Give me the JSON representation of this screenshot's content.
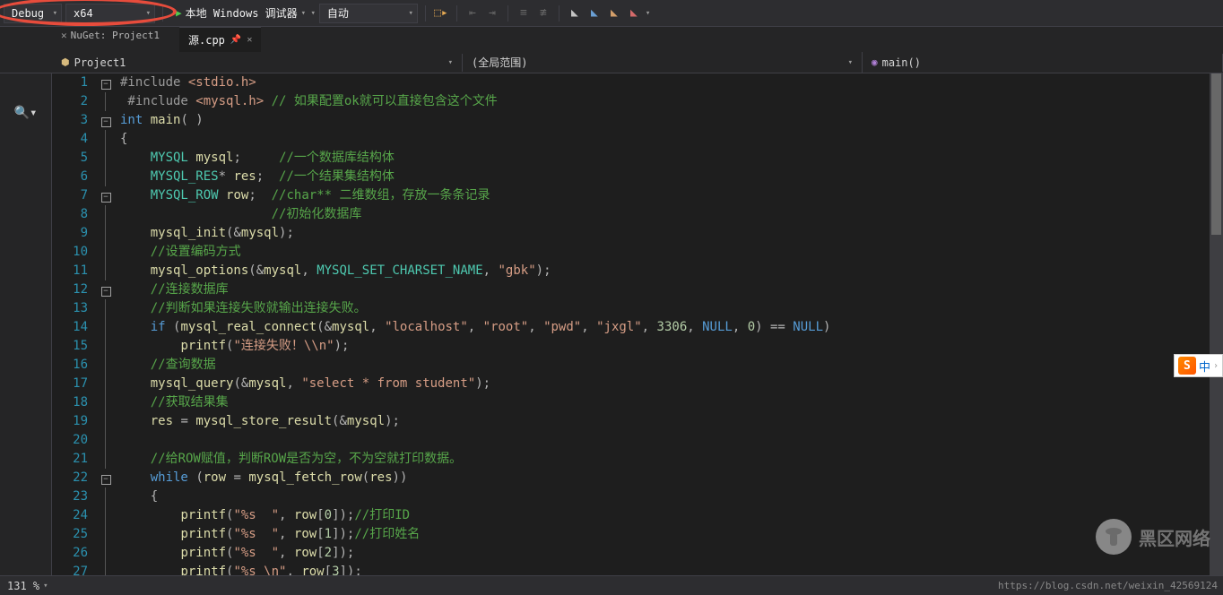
{
  "toolbar": {
    "config": "Debug",
    "platform": "x64",
    "debugger": "本地 Windows 调试器",
    "auto": "自动"
  },
  "dirtyTab": {
    "label": "NuGet: Project1"
  },
  "tab": {
    "label": "源.cpp"
  },
  "nav": {
    "project": "Project1",
    "scope": "(全局范围)",
    "func": "main()"
  },
  "status": {
    "zoom": "131 %"
  },
  "ime": {
    "letter": "S",
    "text": "中"
  },
  "watermark": "黑区网络",
  "attribution": "https://blog.csdn.net/weixin_42569124",
  "code": {
    "lines": [
      {
        "n": "1",
        "fold": "box",
        "tokens": [
          [
            "pp",
            "#include "
          ],
          [
            "str",
            "<stdio.h>"
          ]
        ]
      },
      {
        "n": "2",
        "fold": "bar",
        "tokens": [
          [
            "pp",
            " #include "
          ],
          [
            "str",
            "<mysql.h>"
          ],
          [
            "txt",
            " "
          ],
          [
            "cmt",
            "// 如果配置ok就可以直接包含这个文件"
          ]
        ]
      },
      {
        "n": "3",
        "fold": "box",
        "tokens": [
          [
            "kw",
            "int"
          ],
          [
            "txt",
            " "
          ],
          [
            "id",
            "main"
          ],
          [
            "op",
            "( )"
          ]
        ]
      },
      {
        "n": "4",
        "fold": "bar",
        "tokens": [
          [
            "op",
            "{"
          ]
        ]
      },
      {
        "n": "5",
        "fold": "bar",
        "tokens": [
          [
            "txt",
            "    "
          ],
          [
            "type",
            "MYSQL"
          ],
          [
            "txt",
            " "
          ],
          [
            "id",
            "mysql"
          ],
          [
            "op",
            ";"
          ],
          [
            "txt",
            "     "
          ],
          [
            "cmt",
            "//一个数据库结构体"
          ]
        ]
      },
      {
        "n": "6",
        "fold": "bar",
        "tokens": [
          [
            "txt",
            "    "
          ],
          [
            "type",
            "MYSQL_RES"
          ],
          [
            "op",
            "*"
          ],
          [
            "txt",
            " "
          ],
          [
            "id",
            "res"
          ],
          [
            "op",
            ";"
          ],
          [
            "txt",
            "  "
          ],
          [
            "cmt",
            "//一个结果集结构体"
          ]
        ]
      },
      {
        "n": "7",
        "fold": "box",
        "tokens": [
          [
            "txt",
            "    "
          ],
          [
            "type",
            "MYSQL_ROW"
          ],
          [
            "txt",
            " "
          ],
          [
            "id",
            "row"
          ],
          [
            "op",
            ";"
          ],
          [
            "txt",
            "  "
          ],
          [
            "cmt",
            "//char** 二维数组，存放一条条记录"
          ]
        ]
      },
      {
        "n": "8",
        "fold": "bar",
        "tokens": [
          [
            "txt",
            "                    "
          ],
          [
            "cmt",
            "//初始化数据库"
          ]
        ]
      },
      {
        "n": "9",
        "fold": "bar",
        "tokens": [
          [
            "txt",
            "    "
          ],
          [
            "id",
            "mysql_init"
          ],
          [
            "op",
            "("
          ],
          [
            "op",
            "&"
          ],
          [
            "id",
            "mysql"
          ],
          [
            "op",
            ")"
          ],
          [
            "op",
            ";"
          ]
        ]
      },
      {
        "n": "10",
        "fold": "bar",
        "tokens": [
          [
            "txt",
            "    "
          ],
          [
            "cmt",
            "//设置编码方式"
          ]
        ]
      },
      {
        "n": "11",
        "fold": "bar",
        "tokens": [
          [
            "txt",
            "    "
          ],
          [
            "id",
            "mysql_options"
          ],
          [
            "op",
            "("
          ],
          [
            "op",
            "&"
          ],
          [
            "id",
            "mysql"
          ],
          [
            "op",
            ", "
          ],
          [
            "type",
            "MYSQL_SET_CHARSET_NAME"
          ],
          [
            "op",
            ", "
          ],
          [
            "str",
            "\"gbk\""
          ],
          [
            "op",
            ")"
          ],
          [
            "op",
            ";"
          ]
        ]
      },
      {
        "n": "12",
        "fold": "box",
        "tokens": [
          [
            "txt",
            "    "
          ],
          [
            "cmt",
            "//连接数据库"
          ]
        ]
      },
      {
        "n": "13",
        "fold": "bar",
        "tokens": [
          [
            "txt",
            "    "
          ],
          [
            "cmt",
            "//判断如果连接失败就输出连接失败。"
          ]
        ]
      },
      {
        "n": "14",
        "fold": "bar",
        "tokens": [
          [
            "txt",
            "    "
          ],
          [
            "kw",
            "if"
          ],
          [
            "txt",
            " "
          ],
          [
            "op",
            "("
          ],
          [
            "id",
            "mysql_real_connect"
          ],
          [
            "op",
            "("
          ],
          [
            "op",
            "&"
          ],
          [
            "id",
            "mysql"
          ],
          [
            "op",
            ", "
          ],
          [
            "str",
            "\"localhost\""
          ],
          [
            "op",
            ", "
          ],
          [
            "str",
            "\"root\""
          ],
          [
            "op",
            ", "
          ],
          [
            "str",
            "\"pwd\""
          ],
          [
            "op",
            ", "
          ],
          [
            "str",
            "\"jxgl\""
          ],
          [
            "op",
            ", "
          ],
          [
            "num",
            "3306"
          ],
          [
            "op",
            ", "
          ],
          [
            "null",
            "NULL"
          ],
          [
            "op",
            ", "
          ],
          [
            "num",
            "0"
          ],
          [
            "op",
            ")"
          ],
          [
            "txt",
            " "
          ],
          [
            "op",
            "=="
          ],
          [
            "txt",
            " "
          ],
          [
            "null",
            "NULL"
          ],
          [
            "op",
            ")"
          ]
        ]
      },
      {
        "n": "15",
        "fold": "bar",
        "tokens": [
          [
            "txt",
            "        "
          ],
          [
            "id",
            "printf"
          ],
          [
            "op",
            "("
          ],
          [
            "str",
            "\"连接失败！\\\\n\""
          ],
          [
            "op",
            ")"
          ],
          [
            "op",
            ";"
          ]
        ]
      },
      {
        "n": "16",
        "fold": "bar",
        "tokens": [
          [
            "txt",
            "    "
          ],
          [
            "cmt",
            "//查询数据"
          ]
        ]
      },
      {
        "n": "17",
        "fold": "bar",
        "tokens": [
          [
            "txt",
            "    "
          ],
          [
            "id",
            "mysql_query"
          ],
          [
            "op",
            "("
          ],
          [
            "op",
            "&"
          ],
          [
            "id",
            "mysql"
          ],
          [
            "op",
            ", "
          ],
          [
            "str",
            "\"select * from student\""
          ],
          [
            "op",
            ")"
          ],
          [
            "op",
            ";"
          ]
        ]
      },
      {
        "n": "18",
        "fold": "bar",
        "tokens": [
          [
            "txt",
            "    "
          ],
          [
            "cmt",
            "//获取结果集"
          ]
        ]
      },
      {
        "n": "19",
        "fold": "bar",
        "tokens": [
          [
            "txt",
            "    "
          ],
          [
            "id",
            "res"
          ],
          [
            "txt",
            " "
          ],
          [
            "op",
            "="
          ],
          [
            "txt",
            " "
          ],
          [
            "id",
            "mysql_store_result"
          ],
          [
            "op",
            "("
          ],
          [
            "op",
            "&"
          ],
          [
            "id",
            "mysql"
          ],
          [
            "op",
            ")"
          ],
          [
            "op",
            ";"
          ]
        ]
      },
      {
        "n": "20",
        "fold": "bar",
        "tokens": []
      },
      {
        "n": "21",
        "fold": "bar",
        "tokens": [
          [
            "txt",
            "    "
          ],
          [
            "cmt",
            "//给ROW赋值，判断ROW是否为空，不为空就打印数据。"
          ]
        ]
      },
      {
        "n": "22",
        "fold": "box",
        "tokens": [
          [
            "txt",
            "    "
          ],
          [
            "kw",
            "while"
          ],
          [
            "txt",
            " "
          ],
          [
            "op",
            "("
          ],
          [
            "id",
            "row"
          ],
          [
            "txt",
            " "
          ],
          [
            "op",
            "="
          ],
          [
            "txt",
            " "
          ],
          [
            "id",
            "mysql_fetch_row"
          ],
          [
            "op",
            "("
          ],
          [
            "id",
            "res"
          ],
          [
            "op",
            "))"
          ]
        ]
      },
      {
        "n": "23",
        "fold": "bar",
        "tokens": [
          [
            "txt",
            "    "
          ],
          [
            "op",
            "{"
          ]
        ]
      },
      {
        "n": "24",
        "fold": "bar",
        "tokens": [
          [
            "txt",
            "        "
          ],
          [
            "id",
            "printf"
          ],
          [
            "op",
            "("
          ],
          [
            "str",
            "\"%s  \""
          ],
          [
            "op",
            ", "
          ],
          [
            "id",
            "row"
          ],
          [
            "op",
            "["
          ],
          [
            "num",
            "0"
          ],
          [
            "op",
            "])"
          ],
          [
            "op",
            ";"
          ],
          [
            "cmt",
            "//打印ID"
          ]
        ]
      },
      {
        "n": "25",
        "fold": "bar",
        "tokens": [
          [
            "txt",
            "        "
          ],
          [
            "id",
            "printf"
          ],
          [
            "op",
            "("
          ],
          [
            "str",
            "\"%s  \""
          ],
          [
            "op",
            ", "
          ],
          [
            "id",
            "row"
          ],
          [
            "op",
            "["
          ],
          [
            "num",
            "1"
          ],
          [
            "op",
            "])"
          ],
          [
            "op",
            ";"
          ],
          [
            "cmt",
            "//打印姓名"
          ]
        ]
      },
      {
        "n": "26",
        "fold": "bar",
        "tokens": [
          [
            "txt",
            "        "
          ],
          [
            "id",
            "printf"
          ],
          [
            "op",
            "("
          ],
          [
            "str",
            "\"%s  \""
          ],
          [
            "op",
            ", "
          ],
          [
            "id",
            "row"
          ],
          [
            "op",
            "["
          ],
          [
            "num",
            "2"
          ],
          [
            "op",
            "])"
          ],
          [
            "op",
            ";"
          ]
        ]
      },
      {
        "n": "27",
        "fold": "bar",
        "tokens": [
          [
            "txt",
            "        "
          ],
          [
            "id",
            "printf"
          ],
          [
            "op",
            "("
          ],
          [
            "str",
            "\"%s \\n\""
          ],
          [
            "op",
            ", "
          ],
          [
            "id",
            "row"
          ],
          [
            "op",
            "["
          ],
          [
            "num",
            "3"
          ],
          [
            "op",
            "])"
          ],
          [
            "op",
            ";"
          ]
        ]
      }
    ]
  }
}
